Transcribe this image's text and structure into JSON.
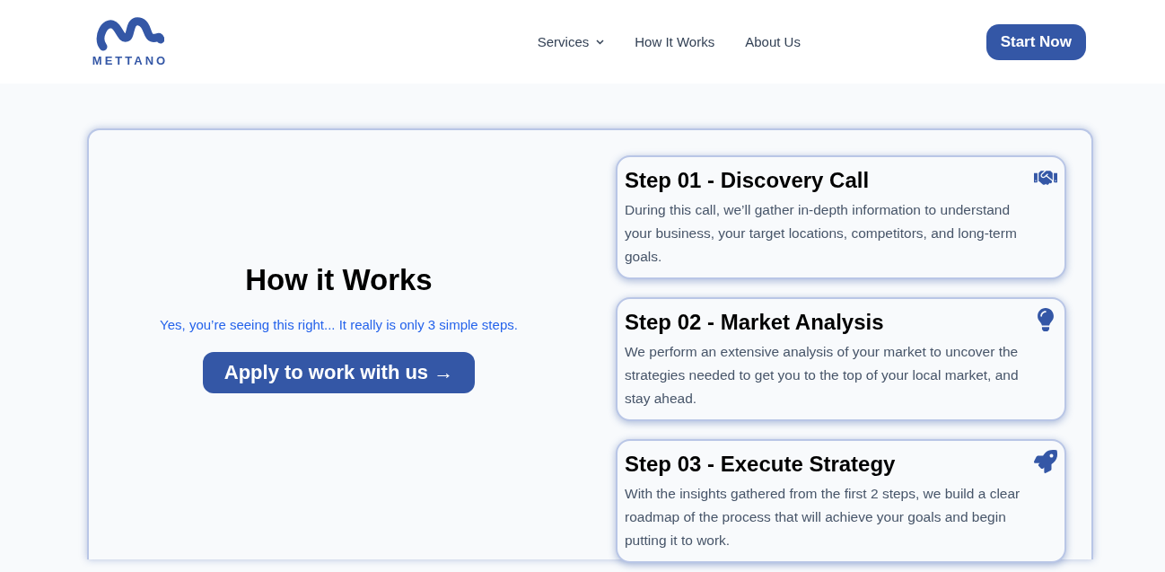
{
  "header": {
    "logo_text": "METTANO",
    "nav": [
      {
        "label": "Services",
        "dropdown": true
      },
      {
        "label": "How It Works",
        "dropdown": false
      },
      {
        "label": "About Us",
        "dropdown": false
      }
    ],
    "cta": "Start Now"
  },
  "intro": {
    "title": "How it Works",
    "subtitle": "Yes, you’re seeing this right... It really is only 3 simple steps.",
    "button": "Apply to work with us →"
  },
  "steps": [
    {
      "title": "Step 01 - Discovery Call",
      "text": "During this call, we’ll gather in-depth information to understand your business, your target locations, competitors, and long-term goals.",
      "kind": "handshake"
    },
    {
      "title": "Step 02 - Market Analysis",
      "text": "We perform an extensive analysis of your market to uncover the strategies needed to get you to the top of your local market, and stay ahead.",
      "kind": "lightbulb"
    },
    {
      "title": "Step 03 - Execute Strategy",
      "text": "With the insights gathered from the first 2 steps, we build a clear roadmap of the process that will achieve your goals and begin putting it to work.",
      "kind": "rocket"
    }
  ]
}
